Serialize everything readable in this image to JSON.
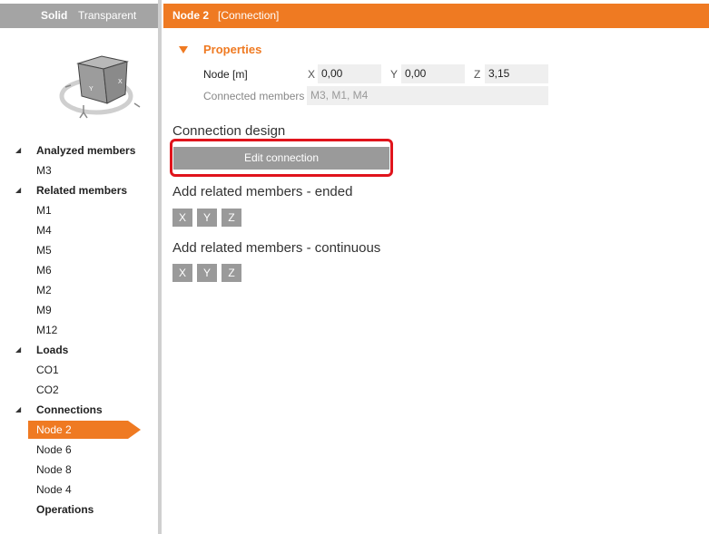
{
  "view_toggle": {
    "solid": "Solid",
    "transparent": "Transparent"
  },
  "tree": [
    {
      "label": "Analyzed members",
      "group": true
    },
    {
      "label": "M3",
      "group": false
    },
    {
      "label": "Related members",
      "group": true
    },
    {
      "label": "M1",
      "group": false
    },
    {
      "label": "M4",
      "group": false
    },
    {
      "label": "M5",
      "group": false
    },
    {
      "label": "M6",
      "group": false
    },
    {
      "label": "M2",
      "group": false
    },
    {
      "label": "M9",
      "group": false
    },
    {
      "label": "M12",
      "group": false
    },
    {
      "label": "Loads",
      "group": true
    },
    {
      "label": "CO1",
      "group": false
    },
    {
      "label": "CO2",
      "group": false
    },
    {
      "label": "Connections",
      "group": true
    },
    {
      "label": "Node 2",
      "group": false,
      "selected": true
    },
    {
      "label": "Node 6",
      "group": false
    },
    {
      "label": "Node 8",
      "group": false
    },
    {
      "label": "Node 4",
      "group": false
    },
    {
      "label": "Operations",
      "group": true,
      "no_arrow": true
    }
  ],
  "header": {
    "title": "Node 2",
    "subtitle": "[Connection]"
  },
  "properties": {
    "title": "Properties",
    "node_label": "Node [m]",
    "x_label": "X",
    "x_value": "0,00",
    "y_label": "Y",
    "y_value": "0,00",
    "z_label": "Z",
    "z_value": "3,15",
    "connected_label": "Connected members",
    "connected_value": "M3, M1, M4"
  },
  "connection_design": {
    "title": "Connection design",
    "edit_button": "Edit connection"
  },
  "related_ended": {
    "title": "Add related members - ended",
    "buttons": [
      "X",
      "Y",
      "Z"
    ]
  },
  "related_continuous": {
    "title": "Add related members - continuous",
    "buttons": [
      "X",
      "Y",
      "Z"
    ]
  },
  "colors": {
    "accent": "#ef7a22",
    "highlight": "#e0141c",
    "button_gray": "#9a9a9a"
  }
}
